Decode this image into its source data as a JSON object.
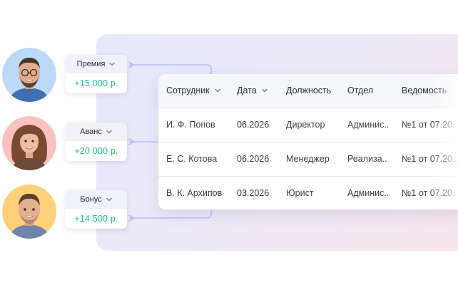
{
  "payments": [
    {
      "type_label": "Премия",
      "amount": "+15 000 р."
    },
    {
      "type_label": "Аванс",
      "amount": "+20 000 р."
    },
    {
      "type_label": "Бонус",
      "amount": "+14 500 р."
    }
  ],
  "table": {
    "headers": {
      "employee": "Сотрудник",
      "date": "Дата",
      "position": "Должность",
      "department": "Отдел",
      "statement": "Ведомость"
    },
    "rows": [
      {
        "employee": "И. Ф. Попов",
        "date": "06.2026",
        "position": "Директор",
        "department": "Админис..",
        "statement": "№1 от 07.20.."
      },
      {
        "employee": "Е. С. Котова",
        "date": "06.2026",
        "position": "Менеджер",
        "department": "Реализа..",
        "statement": "№1 от 07.20.."
      },
      {
        "employee": "В. К. Архипов",
        "date": "03.2026",
        "position": "Юрист",
        "department": "Админис..",
        "statement": "№1 от 07.20.."
      }
    ]
  },
  "colors": {
    "amount_green": "#1fbf82",
    "connector_blue": "#a9b8f5",
    "avatar_ring_1": "#bcd9f7",
    "avatar_ring_2": "#f9c1c1",
    "avatar_ring_3": "#ffcf7a"
  },
  "icons": [
    "chevron-down-icon",
    "arrow-left-icon"
  ]
}
